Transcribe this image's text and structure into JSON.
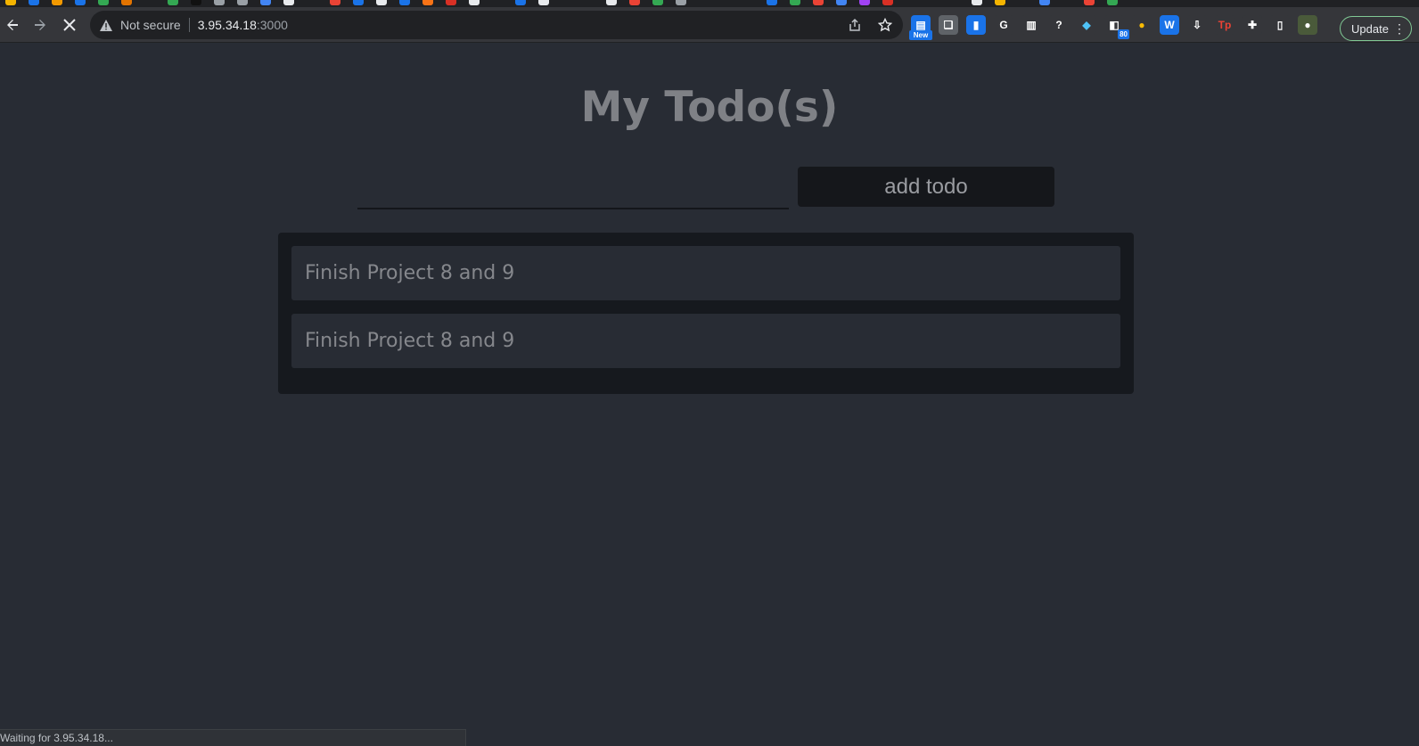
{
  "browser": {
    "security_label": "Not secure",
    "url_host": "3.95.34.18",
    "url_port": ":3000",
    "update_label": "Update",
    "status_text": "Waiting for 3.95.34.18...",
    "extensions": [
      {
        "name": "news-extension-icon",
        "glyph": "▤",
        "color": "#1a73e8",
        "badge": "New"
      },
      {
        "name": "scrolls-extension-icon",
        "glyph": "❏",
        "color": "#5f6368"
      },
      {
        "name": "analytics-extension-icon",
        "glyph": "▮",
        "color": "#1a73e8"
      },
      {
        "name": "grammarly-extension-icon",
        "glyph": "G",
        "color": "#35363a"
      },
      {
        "name": "reader-extension-icon",
        "glyph": "▥",
        "color": "#35363a"
      },
      {
        "name": "help-extension-icon",
        "glyph": "?",
        "color": "#35363a"
      },
      {
        "name": "gem-extension-icon",
        "glyph": "◆",
        "color": "#35363a"
      },
      {
        "name": "counter-extension-icon",
        "glyph": "◧",
        "color": "#35363a",
        "badge_small": "80"
      },
      {
        "name": "coin-extension-icon",
        "glyph": "●",
        "color": "#35363a"
      },
      {
        "name": "wave-extension-icon",
        "glyph": "W",
        "color": "#1a73e8"
      },
      {
        "name": "download-extension-icon",
        "glyph": "⇩",
        "color": "#35363a"
      },
      {
        "name": "tp-extension-icon",
        "glyph": "Tp",
        "color": "#35363a"
      },
      {
        "name": "puzzle-extensions-icon",
        "glyph": "✚",
        "color": "#35363a"
      },
      {
        "name": "sidepanel-icon",
        "glyph": "▯",
        "color": "#35363a"
      },
      {
        "name": "profile-avatar-icon",
        "glyph": "●",
        "color": "#4a5a3a"
      }
    ]
  },
  "app": {
    "title": "My Todo(s)",
    "input_value": "",
    "add_button_label": "add todo",
    "todos": [
      {
        "text": "Finish Project 8 and 9"
      },
      {
        "text": "Finish Project 8 and 9"
      }
    ]
  },
  "colors": {
    "page_bg": "#282c34",
    "panel_bg": "#16191e",
    "title_color": "#7f8186",
    "update_border": "#81c995"
  }
}
